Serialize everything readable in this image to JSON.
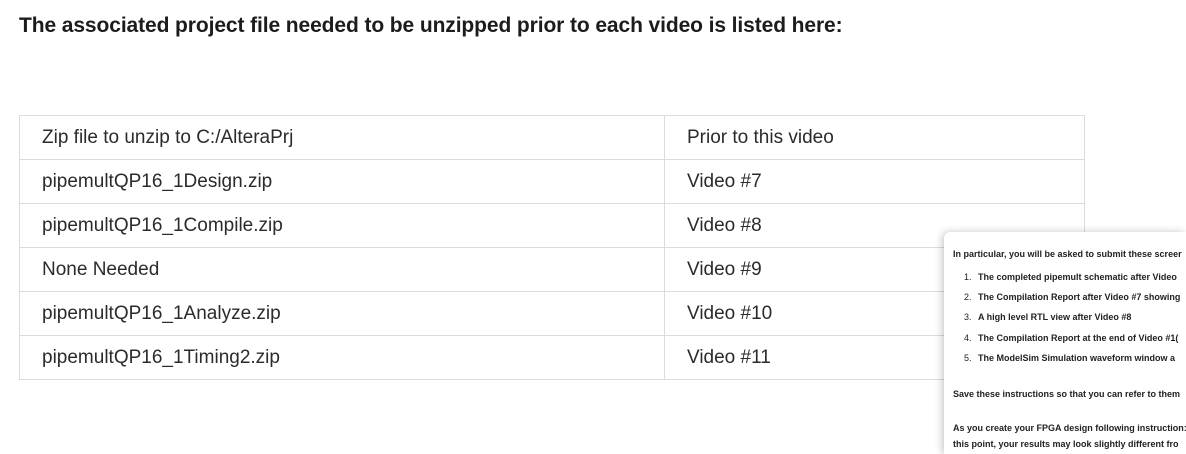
{
  "heading": "The associated project file needed to be unzipped prior to each video is listed here:",
  "table": {
    "header": [
      "Zip file to unzip to C:/AlteraPrj",
      "Prior to this video"
    ],
    "rows": [
      [
        "pipemultQP16_1Design.zip",
        "Video #7"
      ],
      [
        "pipemultQP16_1Compile.zip",
        "Video #8"
      ],
      [
        "None Needed",
        "Video #9"
      ],
      [
        "pipemultQP16_1Analyze.zip",
        "Video #10"
      ],
      [
        "pipemultQP16_1Timing2.zip",
        "Video #11"
      ]
    ]
  },
  "overlay": {
    "intro": "In particular, you will be asked to submit these screer",
    "items": [
      {
        "num": "1.",
        "text": "The completed pipemult schematic after Video"
      },
      {
        "num": "2.",
        "text": "The Compilation Report after Video #7 showing"
      },
      {
        "num": "3.",
        "text": "A high level RTL view after Video #8"
      },
      {
        "num": "4.",
        "text": "The Compilation Report at the end of Video #1("
      },
      {
        "num": "5.",
        "text": "The ModelSim Simulation waveform window a"
      }
    ],
    "save_text": "Save these instructions so that you can refer to them",
    "para_line1": "As you create your FPGA design following instruction:",
    "para_line2": "this point, your results may look slightly different fro"
  }
}
